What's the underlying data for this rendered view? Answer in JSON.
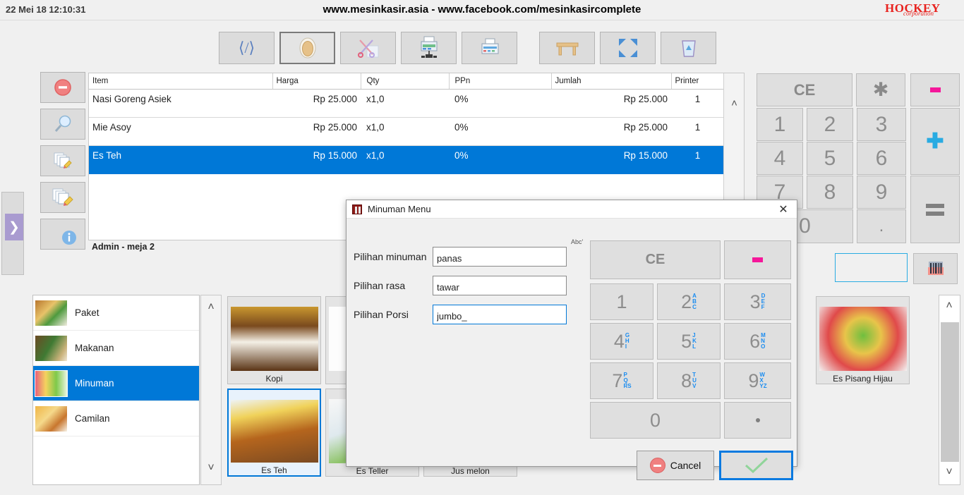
{
  "topbar": {
    "datetime": "22 Mei 18 12:10:31",
    "title": "www.mesinkasir.asia - www.facebook.com/mesinkasircomplete",
    "logo_main": "HOCKEY",
    "logo_sub": "corporation"
  },
  "toolbar": {
    "buttons": [
      {
        "name": "code-icon",
        "label": "</>",
        "selected": false
      },
      {
        "name": "cash-drawer-icon",
        "label": "",
        "selected": true
      },
      {
        "name": "scissors-cut-icon",
        "label": "",
        "selected": false
      },
      {
        "name": "printer-network-icon",
        "label": "",
        "selected": false
      },
      {
        "name": "printer-icon",
        "label": "",
        "selected": false
      },
      {
        "name": "table-icon",
        "label": "",
        "selected": false
      },
      {
        "name": "fullscreen-icon",
        "label": "",
        "selected": false
      },
      {
        "name": "delete-trash-icon",
        "label": "",
        "selected": false
      }
    ]
  },
  "side_buttons": [
    {
      "name": "remove-item-button",
      "icon": "minus-circle-icon"
    },
    {
      "name": "search-item-button",
      "icon": "magnifier-icon"
    },
    {
      "name": "edit-note-button",
      "icon": "pages-pencil-icon"
    },
    {
      "name": "edit-document-button",
      "icon": "pages-pencil-large-icon"
    },
    {
      "name": "info-button",
      "icon": "info-circle-icon"
    }
  ],
  "edge_expander": {
    "arrow": "❯"
  },
  "order": {
    "columns": [
      "Item",
      "Harga",
      "Qty",
      "PPn",
      "Jumlah",
      "Printer"
    ],
    "rows": [
      {
        "item": "Nasi Goreng Asiek",
        "harga": "Rp 25.000",
        "qty": "x1,0",
        "ppn": "0%",
        "jumlah": "Rp 25.000",
        "printer": "1",
        "selected": false
      },
      {
        "item": "Mie Asoy",
        "harga": "Rp 25.000",
        "qty": "x1,0",
        "ppn": "0%",
        "jumlah": "Rp 25.000",
        "printer": "1",
        "selected": false
      },
      {
        "item": "Es Teh",
        "harga": "Rp 15.000",
        "qty": "x1,0",
        "ppn": "0%",
        "jumlah": "Rp 15.000",
        "printer": "1",
        "selected": true
      }
    ],
    "status": "Admin - meja 2",
    "scroll_up": "˄"
  },
  "keypad": {
    "ce": "CE",
    "star": "✱",
    "minus_name": "minus-button",
    "plus": "✚",
    "equals_name": "equals-button",
    "keys": [
      "1",
      "2",
      "3",
      "4",
      "5",
      "6",
      "7",
      "8",
      "9",
      "0",
      "."
    ],
    "barcode_value": "",
    "barcode_button": "barcode-scan-button"
  },
  "categories": [
    {
      "label": "Paket",
      "selected": false
    },
    {
      "label": "Makanan",
      "selected": false
    },
    {
      "label": "Minuman",
      "selected": true
    },
    {
      "label": "Camilan",
      "selected": false
    }
  ],
  "products": [
    {
      "name": "Kopi",
      "selected": false
    },
    {
      "name": "Es Teh",
      "selected": true
    },
    {
      "name": "Es Teller",
      "selected": false
    },
    {
      "name": "Jus melon",
      "selected": false
    },
    {
      "name": "Es Pisang Hijau",
      "selected": false
    }
  ],
  "modal": {
    "title": "Minuman Menu",
    "close": "✕",
    "fields": [
      {
        "label": "Pilihan minuman",
        "value": "panas",
        "active": false
      },
      {
        "label": "Pilihan rasa",
        "value": "tawar",
        "active": false
      },
      {
        "label": "Pilihan Porsi",
        "value": "jumbo_",
        "active": true
      }
    ],
    "abc_tag": "Abc'",
    "ce": "CE",
    "keys": [
      {
        "digit": "1",
        "letters": ""
      },
      {
        "digit": "2",
        "letters": "ABC"
      },
      {
        "digit": "3",
        "letters": "DEF"
      },
      {
        "digit": "4",
        "letters": "GHI"
      },
      {
        "digit": "5",
        "letters": "JKL"
      },
      {
        "digit": "6",
        "letters": "MNO"
      },
      {
        "digit": "7",
        "letters": "PQRS"
      },
      {
        "digit": "8",
        "letters": "TUV"
      },
      {
        "digit": "9",
        "letters": "WXYZ"
      },
      {
        "digit": "0",
        "letters": ""
      }
    ],
    "cancel_label": "Cancel",
    "ok_name": "confirm-button"
  },
  "colors": {
    "accent_blue": "#0078d7",
    "pink": "#f5179a",
    "cyan": "#29abe2",
    "logo_red": "#e8221e",
    "lavender": "#a99bd0"
  }
}
